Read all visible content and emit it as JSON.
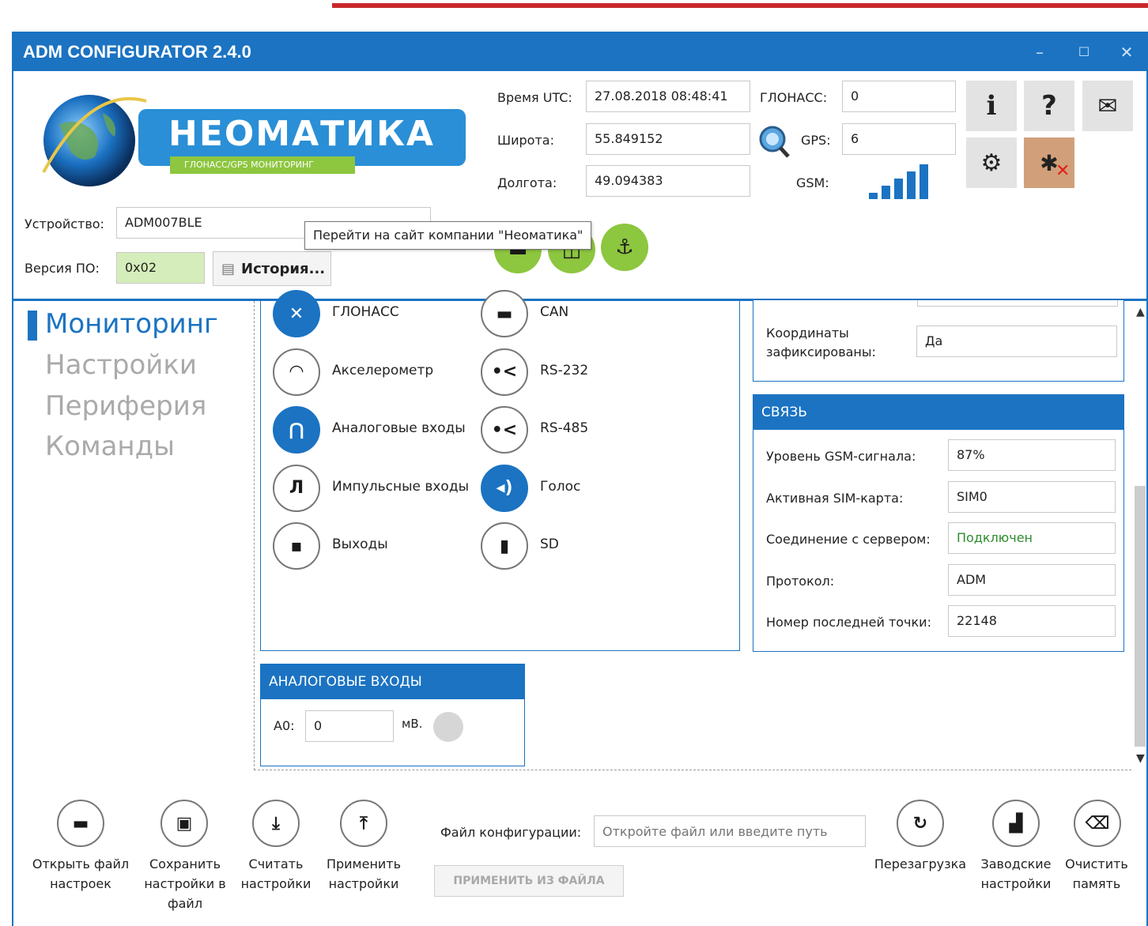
{
  "app": {
    "title": "ADM CONFIGURATOR 2.4.0"
  },
  "window_controls": {
    "minimize": "–",
    "maximize": "☐",
    "close": "✕"
  },
  "logo": {
    "wordmark": "НЕОМАТИКА",
    "tagline": "ГЛОНАСС/GPS МОНИТОРИНГ"
  },
  "status": {
    "utc_label": "Время UTC:",
    "utc_value": "27.08.2018 08:48:41",
    "lat_label": "Широта:",
    "lat_value": "55.849152",
    "lon_label": "Долгота:",
    "lon_value": "49.094383",
    "glonass_label": "ГЛОНАСС:",
    "glonass_value": "0",
    "gps_label": "GPS:",
    "gps_value": "6",
    "gsm_label": "GSM:",
    "gsm_bars": 5
  },
  "action_icons": {
    "info": "i",
    "help": "?",
    "mail": "✉",
    "settings": "⚙",
    "bluetooth": "✱"
  },
  "device": {
    "device_label": "Устройство:",
    "device_value": "ADM007BLE",
    "fw_label": "Версия ПО:",
    "fw_value": "0x02",
    "history_label": "История..."
  },
  "tooltip": "Перейти на сайт компании \"Неоматика\"",
  "nav": [
    "Мониторинг",
    "Настройки",
    "Периферия",
    "Команды"
  ],
  "modules_left": [
    {
      "label": "ГЛОНАСС",
      "icon": "satellite-icon",
      "glyph": "✕",
      "on": true
    },
    {
      "label": "Акселерометр",
      "icon": "gauge-icon",
      "glyph": "◠",
      "on": false
    },
    {
      "label": "Аналоговые входы",
      "icon": "analog-wave-icon",
      "glyph": "⋂",
      "on": true
    },
    {
      "label": "Импульсные входы",
      "icon": "pulse-icon",
      "glyph": "Л",
      "on": false
    },
    {
      "label": "Выходы",
      "icon": "outputs-icon",
      "glyph": "▪",
      "on": false
    }
  ],
  "modules_right": [
    {
      "label": "CAN",
      "icon": "car-icon",
      "glyph": "▬",
      "on": false
    },
    {
      "label": "RS-232",
      "icon": "rs232-icon",
      "glyph": "•<",
      "on": false
    },
    {
      "label": "RS-485",
      "icon": "rs485-icon",
      "glyph": "•<",
      "on": false
    },
    {
      "label": "Голос",
      "icon": "speaker-icon",
      "glyph": "◂)",
      "on": true
    },
    {
      "label": "SD",
      "icon": "sd-card-icon",
      "glyph": "▮",
      "on": false
    }
  ],
  "coords": {
    "label": "Координаты зафиксированы:",
    "value": "Да"
  },
  "link": {
    "title": "СВЯЗЬ",
    "rows": [
      {
        "label": "Уровень GSM-сигнала:",
        "value": "87%"
      },
      {
        "label": "Активная SIM-карта:",
        "value": "SIM0"
      },
      {
        "label": "Соединение с сервером:",
        "value": "Подключен"
      },
      {
        "label": "Протокол:",
        "value": "ADM"
      },
      {
        "label": "Номер последней точки:",
        "value": "22148"
      }
    ],
    "connected_color": "#2e8b2e"
  },
  "analog": {
    "title": "АНАЛОГОВЫЕ ВХОДЫ",
    "a0_label": "A0:",
    "a0_value": "0",
    "unit": "мВ."
  },
  "toolbar": {
    "open_label": "Открыть файл настроек",
    "save_label": "Сохранить настройки в файл",
    "read_label": "Считать настройки",
    "apply_label": "Применить настройки",
    "config_label": "Файл конфигурации:",
    "config_placeholder": "Откройте файл или введите путь",
    "apply_file_label": "ПРИМЕНИТЬ ИЗ ФАЙЛА",
    "reboot_label": "Перезагрузка",
    "factory_label": "Заводские настройки",
    "clear_label": "Очистить память"
  },
  "colors": {
    "accent": "#1b73c2",
    "green": "#8dc63f",
    "alert_bt": "#d1a07a"
  }
}
